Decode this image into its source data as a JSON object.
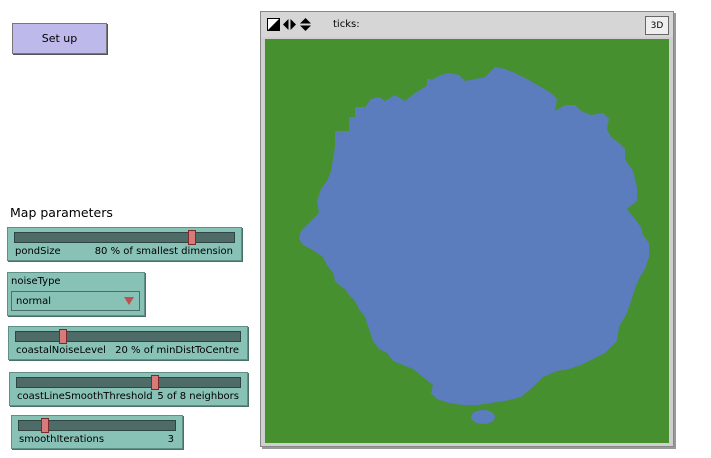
{
  "buttons": {
    "setup": "Set up"
  },
  "section": {
    "map_parameters": "Map parameters"
  },
  "sliders": {
    "pondSize": {
      "name": "pondSize",
      "value_text": "80 % of smallest dimension",
      "fraction": 0.82
    },
    "coastalNoiseLevel": {
      "name": "coastalNoiseLevel",
      "value_text": "20 % of minDistToCentre",
      "fraction": 0.2
    },
    "coastLineSmoothThreshold": {
      "name": "coastLineSmoothThreshold",
      "value_text": "5 of 8 neighbors",
      "fraction": 0.625
    },
    "smoothIterations": {
      "name": "smoothIterations",
      "value_text": "3",
      "fraction": 0.15
    }
  },
  "chooser": {
    "name": "noiseType",
    "value": "normal"
  },
  "view": {
    "ticks_label": "ticks:",
    "btn_3d": "3D",
    "land_color": "#46902f",
    "water_color": "#5b7cbd"
  }
}
